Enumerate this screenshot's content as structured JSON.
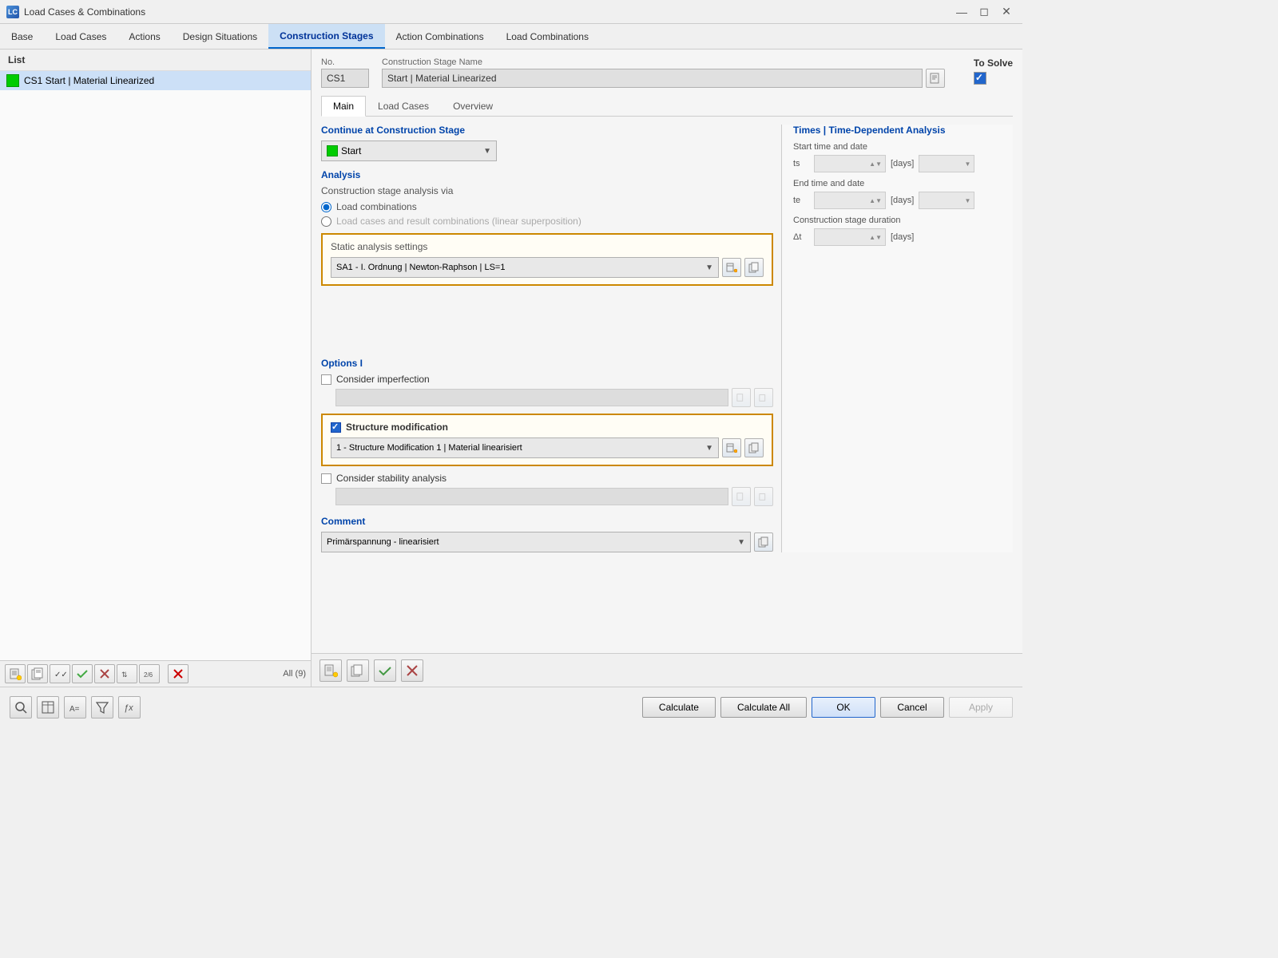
{
  "window": {
    "title": "Load Cases & Combinations",
    "icon": "LC"
  },
  "menubar": {
    "items": [
      {
        "label": "Base",
        "active": false
      },
      {
        "label": "Load Cases",
        "active": false
      },
      {
        "label": "Actions",
        "active": false
      },
      {
        "label": "Design Situations",
        "active": false
      },
      {
        "label": "Construction Stages",
        "active": true
      },
      {
        "label": "Action Combinations",
        "active": false
      },
      {
        "label": "Load Combinations",
        "active": false
      }
    ]
  },
  "left_panel": {
    "header": "List",
    "list_items": [
      {
        "id": "CS1",
        "label": "CS1  Start | Material Linearized",
        "selected": true
      }
    ],
    "all_count": "All (9)"
  },
  "right_panel": {
    "no_label": "No.",
    "no_value": "CS1",
    "name_label": "Construction Stage Name",
    "name_value": "Start | Material Linearized",
    "to_solve_label": "To Solve",
    "to_solve_checked": true,
    "tabs": [
      {
        "label": "Main",
        "active": true
      },
      {
        "label": "Load Cases",
        "active": false
      },
      {
        "label": "Overview",
        "active": false
      }
    ],
    "continue_section": {
      "title": "Continue at Construction Stage",
      "value": "Start"
    },
    "analysis_section": {
      "title": "Analysis",
      "subtitle": "Construction stage analysis via",
      "radio1": "Load combinations",
      "radio2": "Load cases and result combinations (linear superposition)",
      "radio1_selected": true
    },
    "static_analysis": {
      "title": "Static analysis settings",
      "value": "SA1 - I. Ordnung | Newton-Raphson | LS=1"
    },
    "options_section": {
      "title": "Options I",
      "consider_imperfection": false,
      "structure_modification": true,
      "structure_mod_value": "1 - Structure Modification 1 | Material linearisiert",
      "consider_stability": false
    },
    "comment_section": {
      "title": "Comment",
      "value": "Primärspannung - linearisiert"
    },
    "times_section": {
      "title": "Times | Time-Dependent Analysis",
      "start_label": "Start time and date",
      "ts_label": "ts",
      "days_label": "[days]",
      "end_label": "End time and date",
      "te_label": "te",
      "duration_label": "Construction stage duration",
      "delta_label": "Δt"
    }
  },
  "footer": {
    "calculate_label": "Calculate",
    "calculate_all_label": "Calculate All",
    "ok_label": "OK",
    "cancel_label": "Cancel",
    "apply_label": "Apply"
  },
  "toolbar": {
    "new_label": "New",
    "copy_label": "Copy",
    "delete_label": "Delete"
  }
}
